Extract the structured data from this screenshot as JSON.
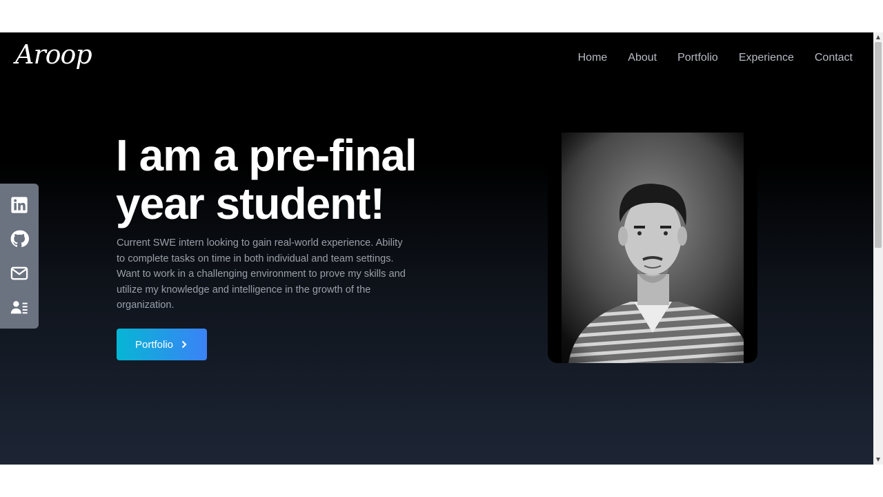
{
  "brand": {
    "logo_text": "Aroop"
  },
  "nav": {
    "items": [
      {
        "label": "Home"
      },
      {
        "label": "About"
      },
      {
        "label": "Portfolio"
      },
      {
        "label": "Experience"
      },
      {
        "label": "Contact"
      }
    ]
  },
  "hero": {
    "title_line1": "I am a pre-final",
    "title_line2": "year student!",
    "description": "Current SWE intern looking to gain real-world experience. Ability to complete tasks on time in both individual and team settings. Want to work in a challenging environment to prove my skills and utilize my knowledge and intelligence in the growth of the organization.",
    "cta_label": "Portfolio"
  },
  "social": {
    "icons": [
      "linkedin-icon",
      "github-icon",
      "mail-icon",
      "resume-icon"
    ]
  },
  "colors": {
    "accent_start": "#06b6d4",
    "accent_end": "#3b82f6",
    "social_bg": "#6b7280"
  }
}
